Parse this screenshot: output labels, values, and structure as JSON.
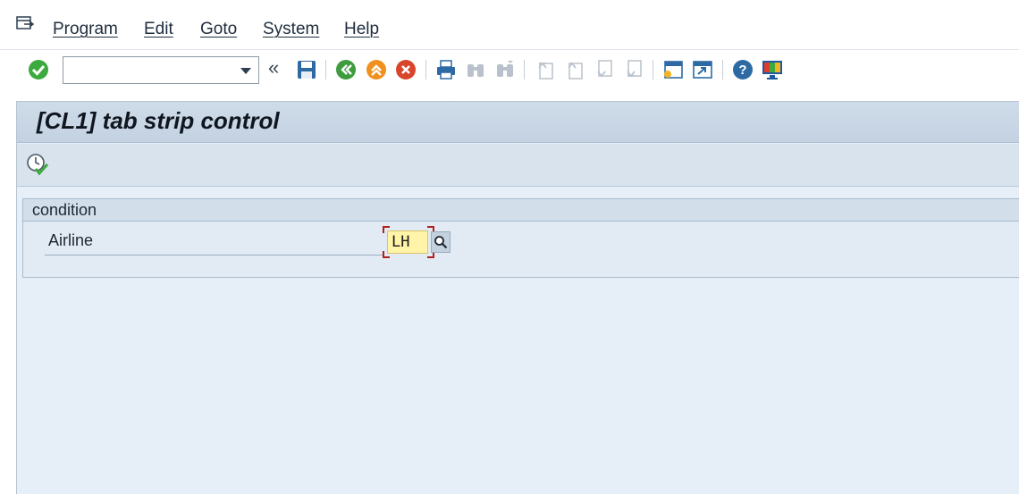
{
  "menubar": {
    "items": [
      {
        "label": "Program"
      },
      {
        "label": "Edit"
      },
      {
        "label": "Goto"
      },
      {
        "label": "System"
      },
      {
        "label": "Help"
      }
    ]
  },
  "toolbar": {
    "command_field_value": "",
    "icons": [
      "enter-icon",
      "save-icon",
      "back-icon",
      "exit-icon",
      "cancel-icon",
      "print-icon",
      "find-icon",
      "find-next-icon",
      "first-page-icon",
      "previous-page-icon",
      "next-page-icon",
      "last-page-icon",
      "create-session-icon",
      "shortcut-icon",
      "help-icon",
      "layout-icon"
    ]
  },
  "screen": {
    "title": "[CL1] tab strip control",
    "frame_title": "condition",
    "field_label": "Airline",
    "field_value": "LH"
  },
  "colors": {
    "title_bar": "#c9d7e6",
    "content_bg": "#e6eef7",
    "input_bg": "#fff4a8",
    "focus_bracket": "#b21f1f",
    "enter_green": "#3daa3d",
    "exit_orange": "#f0901e",
    "cancel_red": "#d9452b"
  }
}
